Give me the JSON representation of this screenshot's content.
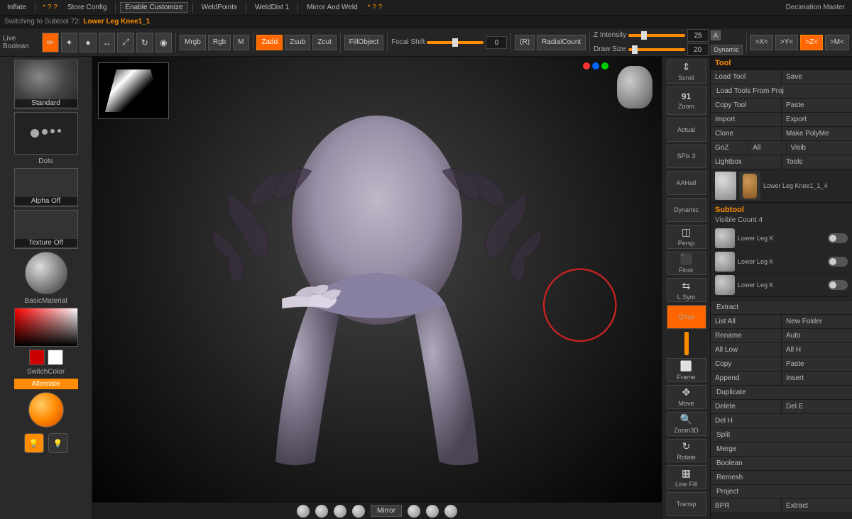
{
  "topbar": {
    "inflate_label": "Inflate",
    "store_config_label": "Store Config",
    "enable_customize_label": "Enable Customize",
    "weld_points_label": "WeldPoints",
    "weld_dist_label": "WeldDist 1",
    "mirror_and_weld_label": "Mirror And Weld",
    "decimation_master_label": "Decimation Master",
    "xyz_symbol": "* ? ?"
  },
  "subtitle": {
    "prefix": "Switching to Subtool 72:",
    "value": "Lower Leg Knee1_1"
  },
  "toolbar": {
    "mrgb_label": "Mrgb",
    "rgb_label": "Rgb",
    "m_label": "M",
    "zadd_label": "Zadd",
    "zsub_label": "Zsub",
    "zcut_label": "Zcut",
    "fill_object_label": "FillObject",
    "focal_shift_label": "Focal Shift",
    "focal_shift_value": "0",
    "r_label": "(R)",
    "radial_count_label": "RadialCount",
    "draw_size_label": "Draw Size",
    "draw_size_value": "20",
    "dynamic_label": "Dynamic",
    "z_intensity_label": "Z Intensity",
    "z_intensity_value": "25",
    "a_badge": "A",
    "x_btn": ">X<",
    "y_btn": ">Y<",
    "z_btn": ">Z<",
    "mc_btn": ">M<",
    "live_boolean_label": "Live Boolean"
  },
  "left_panel": {
    "standard_label": "Standard",
    "dots_label": "Dots",
    "alpha_label": "Alpha Off",
    "texture_label": "Texture Off",
    "material_label": "BasicMaterial",
    "gradient_label": "Gradient",
    "switch_color_label": "SwitchColor",
    "alternate_label": "Alternate"
  },
  "right_strip": {
    "scroll_label": "Scroll",
    "zoom_label": "Zoom",
    "zoom_number": "91",
    "actual_label": "Actual",
    "aahalf_label": "AAHalf",
    "dynamic_label": "Dynamic",
    "persp_label": "Persp",
    "floor_label": "Floor",
    "lsym_label": "L.Sym",
    "qxyz_label": "QXyz",
    "frame_label": "Frame",
    "move_label": "Move",
    "zoom3d_label": "Zoom3D",
    "rotate_label": "Rotate",
    "line_fill_label": "Line Fill",
    "transp_label": "Transp",
    "spix_label": "SPix 3"
  },
  "far_right": {
    "tool_header": "Tool",
    "load_tool_label": "Load Tool",
    "save_label": "Save",
    "load_tools_from_proj_label": "Load Tools From Proj",
    "copy_tool_label": "Copy Tool",
    "paste_label": "Paste",
    "import_label": "Import",
    "export_label": "Export",
    "clone_label": "Clone",
    "make_polymesh_label": "Make PolyMe",
    "goz_label": "GoZ",
    "all_label": "All",
    "visible_label": "Visib",
    "lightbox_label": "Lightbox",
    "tools_label": "Tools",
    "current_tool_label": "Lower Leg Knee1_1_4",
    "subtool_header": "Subtool",
    "visible_count_label": "Visible Count 4",
    "subtool_items": [
      {
        "name": "Lower Leg K",
        "toggle": false
      },
      {
        "name": "Lower Leg K",
        "toggle": false
      },
      {
        "name": "Lower Leg K",
        "toggle": false
      }
    ],
    "extract_label": "Extract",
    "list_all_label": "List All",
    "new_folder_label": "New Folder",
    "rename_label": "Rename",
    "auto_label": "Auto",
    "all_low_label": "All Low",
    "all_h_label": "All H",
    "copy_label": "Copy",
    "paste2_label": "Paste",
    "append_label": "Append",
    "insert_label": "Insert",
    "duplicate_label": "Duplicate",
    "delete_label": "Delete",
    "del_btn1": "Del E",
    "del_btn2": "Del H",
    "split_label": "Split",
    "merge_label": "Merge",
    "boolean_label": "Boolean",
    "remesh_label": "Remesh",
    "project_label": "Project",
    "bpr_label": "BPR",
    "extract2_label": "Extract"
  },
  "viewport": {
    "mirror_label": "Mirror",
    "color_dots": [
      "#ff3333",
      "#0066ff",
      "#00cc00"
    ],
    "red_circle": true
  },
  "colors": {
    "orange": "#ff8c00",
    "active_orange": "#ff6600",
    "bg_dark": "#1e1e1e",
    "panel_bg": "#252525"
  }
}
